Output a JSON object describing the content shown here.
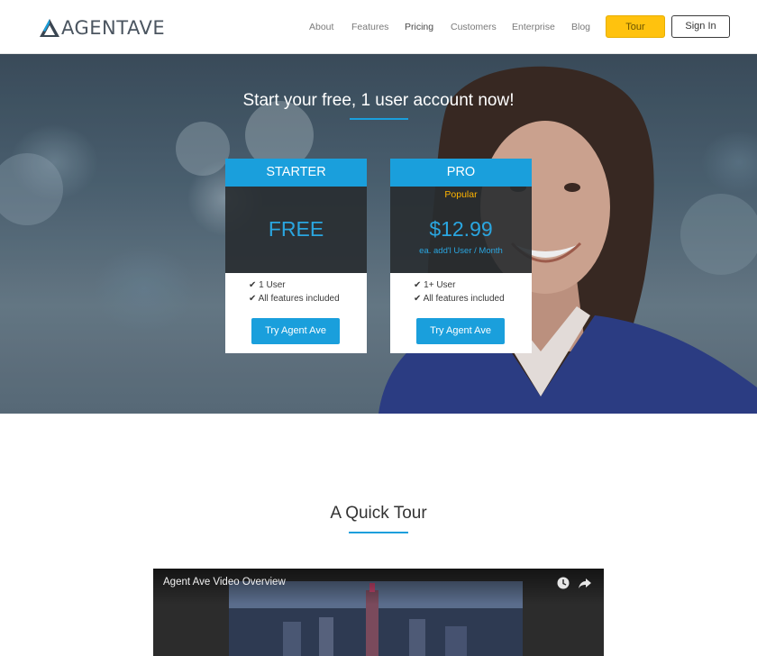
{
  "header": {
    "logo_text": "AGENTAVE",
    "nav": [
      {
        "label": "About"
      },
      {
        "label": "Features"
      },
      {
        "label": "Pricing"
      },
      {
        "label": "Customers"
      },
      {
        "label": "Enterprise"
      },
      {
        "label": "Blog"
      }
    ],
    "tour_label": "Tour",
    "signin_label": "Sign In"
  },
  "hero": {
    "title": "Start your free, 1 user account now!"
  },
  "plans": [
    {
      "name": "STARTER",
      "price": "FREE",
      "features": [
        "✔ 1 User",
        "✔ All features included"
      ],
      "cta": "Try Agent Ave"
    },
    {
      "name": "PRO",
      "badge": "Popular",
      "price": "$12.99",
      "price_note": "ea. add'l User / Month",
      "features": [
        "✔ 1+ User",
        "✔ All features included"
      ],
      "cta": "Try Agent Ave"
    }
  ],
  "tour": {
    "title": "A Quick Tour",
    "video_title": "Agent Ave Video Overview"
  },
  "icons": {
    "logo": "logo-icon",
    "video_watch_later": "clock-icon",
    "video_share": "share-icon"
  },
  "colors": {
    "accent_blue": "#1a9fdc",
    "tour_button": "#ffc20e",
    "popular_text": "#ffb400",
    "card_dark": "#2c3034"
  }
}
